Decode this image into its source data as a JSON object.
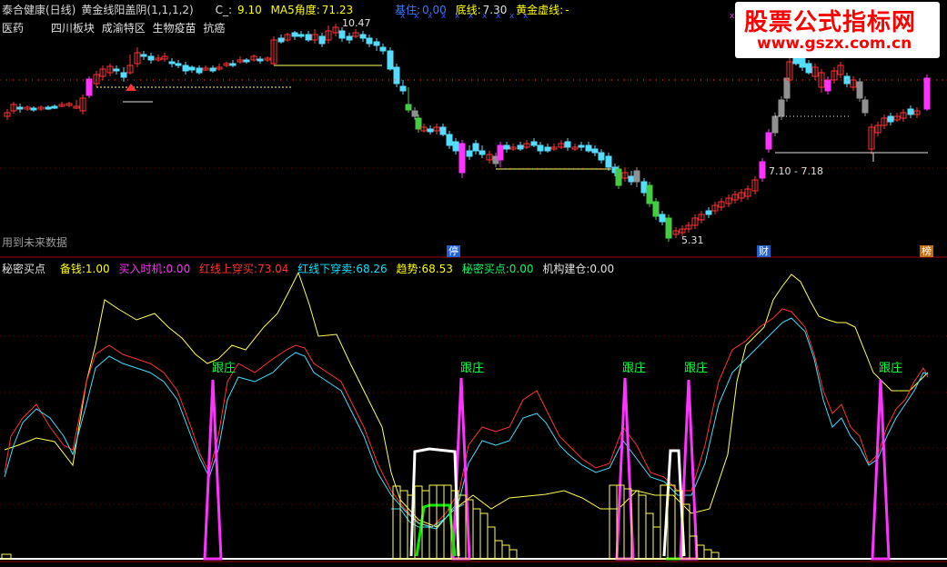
{
  "header": {
    "stock_name": "泰合健康(日线)",
    "indicator_name": "黄金线阳盖阴",
    "indicator_params": "(1,1,1,2)",
    "c_label": "C_:",
    "c_value": "9.10",
    "ma5_label": "MA5角度:",
    "ma5_value": "71.23",
    "base_label": "基住:",
    "base_value": "0.00",
    "bottom_label": "底线:",
    "bottom_value": "7.30",
    "gold_label": "黄金虚线:",
    "gold_value": "-"
  },
  "tags": [
    "医药",
    "四川板块",
    "成渝特区",
    "生物疫苗",
    "抗癌"
  ],
  "watermark": {
    "title": "股票公式指标网",
    "url": "www.gszx.com.cn"
  },
  "price_annotations": {
    "high": "10.47",
    "low": "5.31",
    "range": "7.10 - 7.18"
  },
  "badges": {
    "halt": "停",
    "finance": "财",
    "list": "榜"
  },
  "future_note": "用到未来数据",
  "indicator_header": {
    "name": "秘密买点",
    "items": [
      {
        "label": "备钱:",
        "value": "1.00",
        "color": "#ffff00"
      },
      {
        "label": "买入时机:",
        "value": "0.00",
        "color": "#ff33ff"
      },
      {
        "label": "红线上穿买:",
        "value": "73.04",
        "color": "#ff3333"
      },
      {
        "label": "红线下穿卖:",
        "value": "68.26",
        "color": "#00e5ff"
      },
      {
        "label": "趋势:",
        "value": "68.53",
        "color": "#ffff00"
      },
      {
        "label": "秘密买点:",
        "value": "0.00",
        "color": "#00ff66"
      },
      {
        "label": "机构建仓:",
        "value": "0.00",
        "color": "#e0e0e0"
      }
    ]
  },
  "signal_label": "跟庄",
  "colors": {
    "up": "#ff3333",
    "down": "#55ddff",
    "magenta": "#ff33ff",
    "yellow": "#ffff55",
    "cyan": "#44ddff",
    "red": "#ff3333",
    "green": "#00ff00",
    "white": "#ffffff",
    "grey": "#909090"
  }
}
